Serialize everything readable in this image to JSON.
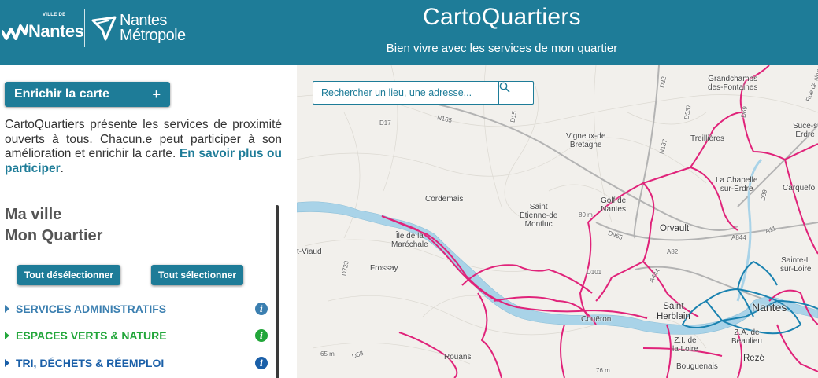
{
  "header": {
    "logo_small": "VILLE DE",
    "logo_city": "Nantes",
    "logo_metro_line1": "Nantes",
    "logo_metro_line2": "Métropole",
    "title": "CartoQuartiers",
    "subtitle": "Bien vivre avec les services de mon quartier"
  },
  "sidebar": {
    "enrich_label": "Enrichir la carte",
    "enrich_plus": "+",
    "intro_text": "CartoQuartiers présente les services de proximité ouverts à tous. Chacun.e peut participer à son amélioration et enrichir la carte.",
    "intro_link": "En savoir plus ou participer",
    "intro_end": ".",
    "section_line1": "Ma ville",
    "section_line2": "Mon Quartier",
    "deselect_all": "Tout désélectionner",
    "select_all": "Tout sélectionner",
    "categories": [
      {
        "label": "SERVICES ADMINISTRATIFS",
        "color": "#3b7fb0",
        "info_color": "#3b7fb0"
      },
      {
        "label": "ESPACES VERTS & NATURE",
        "color": "#22a63a",
        "info_color": "#22a63a"
      },
      {
        "label": "TRI, DÉCHETS & RÉEMPLOI",
        "color": "#1a5fa8",
        "info_color": "#1a5fa8"
      }
    ],
    "info_glyph": "i"
  },
  "map": {
    "search_placeholder": "Rechercher un lieu, une adresse...",
    "search_icon": "search-icon",
    "colors": {
      "boundary": "#e0237a",
      "city_boundary": "#1a82b0",
      "river": "#a9d3e8",
      "land": "#f2f0ec",
      "accent": "#1e7c98"
    },
    "labels": {
      "grandchamps": "Grandchamps\ndes-Fontaines",
      "rue_nort": "Rue de Nort",
      "suce": "Suce-s\nErdre",
      "vigneux": "Vigneux-de\nBretagne",
      "treillieres": "Treillières",
      "chapelle": "La Chapelle\nsur-Erdre",
      "carquefou": "Carquefo",
      "cordemais": "Cordemais",
      "saint_etienne": "Saint\nÉtienne-de\nMontluc",
      "golf": "Golf de\nNantes",
      "orvault": "Orvault",
      "ile_de_la_maréchale": "Île de la\nMaréchale",
      "saint_viaud": "t-Viaud",
      "frossay": "Frossay",
      "saint_herblain": "Saint\nHerblain",
      "nantes": "Nantes",
      "sainte_luce": "Sainte-L\nsur-Loire",
      "coueron": "Couëron",
      "za_beaulieu": "Z.A. de\nBeaulieu",
      "zi_loire": "Z.I. de\nla Loire",
      "rouans": "Rouans",
      "bouguenais": "Bouguenais",
      "reze": "Rezé",
      "elev_80": "80 m",
      "elev_65": "65 m",
      "elev_76": "76 m",
      "road_n165": "N165",
      "road_d17": "D17",
      "road_d15": "D15",
      "road_d32": "D32",
      "road_d537": "D537",
      "road_n137": "N137",
      "road_d69": "D69",
      "road_d39": "D39",
      "road_a844": "A844",
      "road_a11": "A11",
      "road_d965": "D965",
      "road_a82": "A82",
      "road_d101": "D101",
      "road_a444": "A444",
      "road_d723": "D723",
      "road_d58": "D58"
    }
  }
}
